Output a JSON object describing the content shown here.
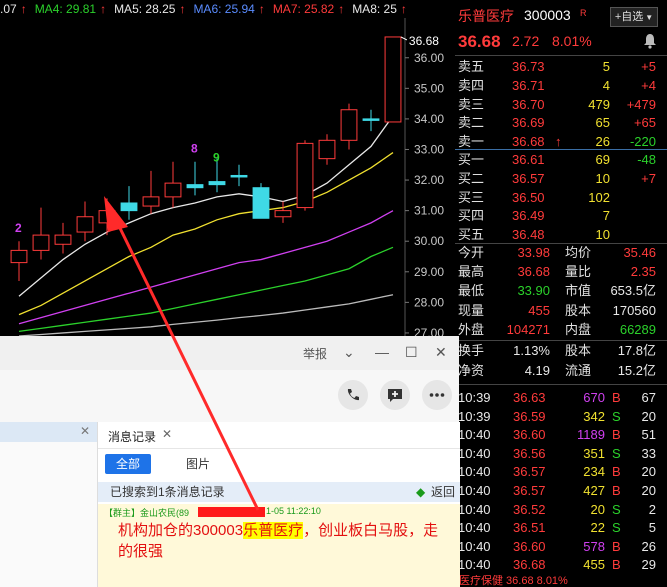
{
  "ma_bar": {
    "items": [
      {
        "label": ".07",
        "color": "#e8e8e8"
      },
      {
        "label": "MA4: 29.81",
        "color": "#2bd12b"
      },
      {
        "label": "MA5: 28.25",
        "color": "#e8e8e8"
      },
      {
        "label": "MA6: 25.94",
        "color": "#5a8cff"
      },
      {
        "label": "MA7: 25.82",
        "color": "#ff3b3b"
      },
      {
        "label": "MA8: 25",
        "color": "#e8e8e8"
      }
    ],
    "arrow_glyph": "↑"
  },
  "chart_data": {
    "type": "candlestick",
    "ylim": [
      26.9,
      37.3
    ],
    "y_ticks": [
      "36.00",
      "35.00",
      "34.00",
      "33.00",
      "32.00",
      "31.00",
      "30.00",
      "29.00",
      "28.00",
      "27.00"
    ],
    "y_tick_values": [
      36,
      35,
      34,
      33,
      32,
      31,
      30,
      29,
      28,
      27
    ],
    "candles": [
      {
        "o": 29.3,
        "c": 29.7,
        "h": 30.0,
        "l": 28.7,
        "up": true
      },
      {
        "o": 29.7,
        "c": 30.2,
        "h": 31.1,
        "l": 29.4,
        "up": true
      },
      {
        "o": 29.9,
        "c": 30.2,
        "h": 30.6,
        "l": 29.6,
        "up": true
      },
      {
        "o": 30.3,
        "c": 30.8,
        "h": 31.3,
        "l": 30.0,
        "up": true
      },
      {
        "o": 30.6,
        "c": 31.0,
        "h": 31.4,
        "l": 30.2,
        "up": true
      },
      {
        "o": 31.0,
        "c": 31.25,
        "h": 31.8,
        "l": 30.7,
        "up": false
      },
      {
        "o": 31.15,
        "c": 31.45,
        "h": 32.3,
        "l": 30.9,
        "up": true
      },
      {
        "o": 31.45,
        "c": 31.9,
        "h": 32.6,
        "l": 31.1,
        "up": true
      },
      {
        "o": 31.85,
        "c": 31.75,
        "h": 32.6,
        "l": 31.5,
        "up": false
      },
      {
        "o": 31.85,
        "c": 31.95,
        "h": 32.7,
        "l": 31.6,
        "up": false
      },
      {
        "o": 32.15,
        "c": 32.15,
        "h": 32.5,
        "l": 31.8,
        "up": false
      },
      {
        "o": 31.75,
        "c": 30.75,
        "h": 31.9,
        "l": 30.75,
        "up": false
      },
      {
        "o": 30.8,
        "c": 31.0,
        "h": 31.3,
        "l": 30.6,
        "up": true
      },
      {
        "o": 31.1,
        "c": 33.2,
        "h": 33.3,
        "l": 31.0,
        "up": true
      },
      {
        "o": 32.7,
        "c": 33.3,
        "h": 33.5,
        "l": 32.5,
        "up": true
      },
      {
        "o": 33.3,
        "c": 34.3,
        "h": 34.5,
        "l": 33.0,
        "up": true
      },
      {
        "o": 34.0,
        "c": 34.0,
        "h": 34.3,
        "l": 33.6,
        "up": false
      },
      {
        "o": 33.9,
        "c": 36.68,
        "h": 36.68,
        "l": 33.9,
        "up": true
      }
    ],
    "annotations": [
      {
        "text": "2",
        "candle": 0,
        "price": 30.3,
        "color": "#d040f0"
      },
      {
        "text": "8",
        "candle": 8,
        "price": 32.9,
        "color": "#d040f0"
      },
      {
        "text": "9",
        "candle": 9,
        "price": 32.6,
        "color": "#2bd12b"
      },
      {
        "text": "36.68",
        "candle": 17,
        "price": 36.68,
        "color": "#ffffff"
      }
    ],
    "lines": [
      {
        "color": "#e8e8e8",
        "values": [
          28.2,
          28.8,
          29.4,
          29.9,
          30.3,
          30.6,
          30.9,
          31.1,
          31.25,
          31.45,
          31.55,
          31.45,
          31.3,
          31.5,
          31.9,
          32.5,
          33.1,
          34.1
        ]
      },
      {
        "color": "#f0e030",
        "values": [
          27.6,
          27.9,
          28.3,
          28.7,
          29.1,
          29.5,
          29.8,
          30.2,
          30.4,
          30.7,
          30.9,
          31.0,
          31.1,
          31.3,
          31.6,
          32.0,
          32.4,
          32.9
        ]
      },
      {
        "color": "#d040f0",
        "values": [
          27.3,
          27.5,
          27.7,
          27.9,
          28.1,
          28.3,
          28.5,
          28.7,
          28.9,
          29.1,
          29.3,
          29.4,
          29.6,
          29.8,
          30.0,
          30.3,
          30.6,
          31.0
        ]
      },
      {
        "color": "#2bd12b",
        "values": [
          27.05,
          27.15,
          27.25,
          27.35,
          27.45,
          27.55,
          27.65,
          27.8,
          27.95,
          28.1,
          28.25,
          28.4,
          28.55,
          28.7,
          28.9,
          29.1,
          29.5,
          29.8
        ]
      },
      {
        "color": "#bbbbbb",
        "values": [
          26.9,
          26.95,
          27.0,
          27.05,
          27.1,
          27.15,
          27.2,
          27.28,
          27.35,
          27.42,
          27.5,
          27.57,
          27.65,
          27.75,
          27.85,
          27.95,
          28.1,
          28.25
        ]
      }
    ]
  },
  "quote": {
    "name": "乐普医疗",
    "code": "300003",
    "r_badge": "R",
    "self_select": "+自选",
    "price": "36.68",
    "change": "2.72",
    "pct": "8.01%",
    "asks": [
      {
        "label": "卖五",
        "price": "36.73",
        "vol": "5",
        "delta": "+5",
        "delta_color": "red"
      },
      {
        "label": "卖四",
        "price": "36.71",
        "vol": "4",
        "delta": "+4",
        "delta_color": "red"
      },
      {
        "label": "卖三",
        "price": "36.70",
        "vol": "479",
        "delta": "+479",
        "delta_color": "red"
      },
      {
        "label": "卖二",
        "price": "36.69",
        "vol": "65",
        "delta": "+65",
        "delta_color": "red"
      },
      {
        "label": "卖一",
        "price": "36.68",
        "vol": "26",
        "delta": "-220",
        "delta_color": "green",
        "arrow": "↑"
      }
    ],
    "bids": [
      {
        "label": "买一",
        "price": "36.61",
        "vol": "69",
        "delta": "-48",
        "delta_color": "green"
      },
      {
        "label": "买二",
        "price": "36.57",
        "vol": "10",
        "delta": "+7",
        "delta_color": "red"
      },
      {
        "label": "买三",
        "price": "36.50",
        "vol": "102",
        "delta": "",
        "delta_color": "red"
      },
      {
        "label": "买四",
        "price": "36.49",
        "vol": "7",
        "delta": "",
        "delta_color": "red"
      },
      {
        "label": "买五",
        "price": "36.48",
        "vol": "10",
        "delta": "",
        "delta_color": "red"
      }
    ],
    "stats": [
      [
        {
          "l": "今开",
          "v": "33.98",
          "c": "red"
        },
        {
          "l": "均价",
          "v": "35.46",
          "c": "red"
        }
      ],
      [
        {
          "l": "最高",
          "v": "36.68",
          "c": "red"
        },
        {
          "l": "量比",
          "v": "2.35",
          "c": "red"
        }
      ],
      [
        {
          "l": "最低",
          "v": "33.90",
          "c": "green"
        },
        {
          "l": "市值",
          "v": "653.5亿",
          "c": "white"
        }
      ],
      [
        {
          "l": "现量",
          "v": "455",
          "c": "red"
        },
        {
          "l": "股本",
          "v": "170560",
          "c": "white"
        }
      ],
      [
        {
          "l": "外盘",
          "v": "104271",
          "c": "red"
        },
        {
          "l": "内盘",
          "v": "66289",
          "c": "green"
        }
      ]
    ],
    "stats2": [
      [
        {
          "l": "换手",
          "v": "1.13%",
          "c": "white"
        },
        {
          "l": "股本",
          "v": "17.8亿",
          "c": "white"
        }
      ],
      [
        {
          "l": "净资",
          "v": "4.19",
          "c": "white"
        },
        {
          "l": "流通",
          "v": "15.2亿",
          "c": "white"
        }
      ]
    ],
    "ticks": [
      {
        "t": "10:39",
        "p": "36.63",
        "v": "670",
        "vc": "magenta",
        "s": "B",
        "sc": "red",
        "n": "67"
      },
      {
        "t": "10:39",
        "p": "36.59",
        "v": "342",
        "vc": "yellow",
        "s": "S",
        "sc": "green",
        "n": "20"
      },
      {
        "t": "10:40",
        "p": "36.60",
        "v": "1189",
        "vc": "magenta",
        "s": "B",
        "sc": "red",
        "n": "51"
      },
      {
        "t": "10:40",
        "p": "36.56",
        "v": "351",
        "vc": "yellow",
        "s": "S",
        "sc": "green",
        "n": "33"
      },
      {
        "t": "10:40",
        "p": "36.57",
        "v": "234",
        "vc": "yellow",
        "s": "B",
        "sc": "red",
        "n": "20"
      },
      {
        "t": "10:40",
        "p": "36.57",
        "v": "427",
        "vc": "yellow",
        "s": "B",
        "sc": "red",
        "n": "20"
      },
      {
        "t": "10:40",
        "p": "36.52",
        "v": "20",
        "vc": "yellow",
        "s": "S",
        "sc": "green",
        "n": "2"
      },
      {
        "t": "10:40",
        "p": "36.51",
        "v": "22",
        "vc": "yellow",
        "s": "S",
        "sc": "green",
        "n": "5"
      },
      {
        "t": "10:40",
        "p": "36.60",
        "v": "578",
        "vc": "magenta",
        "s": "B",
        "sc": "red",
        "n": "26"
      },
      {
        "t": "10:40",
        "p": "36.68",
        "v": "455",
        "vc": "yellow",
        "s": "B",
        "sc": "red",
        "n": "29"
      }
    ],
    "bottom_status": "医疗保健 36.68 8.01%"
  },
  "chat": {
    "report": "举报",
    "history_tab": "消息记录",
    "tab_all": "全部",
    "tab_image": "图片",
    "found_text": "已搜索到1条消息记录",
    "back": "返回",
    "msg_meta": "【群主】金山农民(89",
    "msg_time": "1-05 11:22:10",
    "msg_before": "机构加仓的300003",
    "msg_highlight": "乐普医疗",
    "msg_after": "，创业板白马股，走的很强"
  }
}
